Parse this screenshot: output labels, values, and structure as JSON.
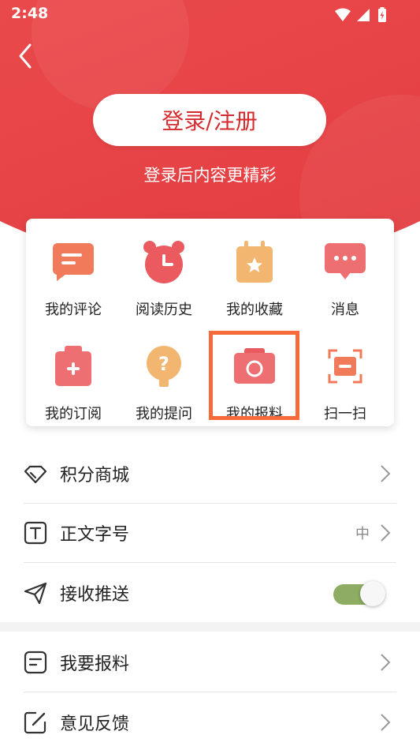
{
  "status_bar": {
    "time": "2:48"
  },
  "header": {
    "login_button": "登录/注册",
    "subtitle": "登录后内容更精彩"
  },
  "grid": {
    "items": [
      {
        "label": "我的评论",
        "icon": "comment-icon"
      },
      {
        "label": "阅读历史",
        "icon": "alarm-clock-icon"
      },
      {
        "label": "我的收藏",
        "icon": "bookmark-star-icon"
      },
      {
        "label": "消息",
        "icon": "message-icon"
      },
      {
        "label": "我的订阅",
        "icon": "subscribe-icon"
      },
      {
        "label": "我的提问",
        "icon": "question-icon"
      },
      {
        "label": "我的报料",
        "icon": "camera-icon"
      },
      {
        "label": "扫一扫",
        "icon": "scan-icon"
      }
    ],
    "highlighted": "我的报料"
  },
  "menu": {
    "points_mall": {
      "label": "积分商城",
      "icon": "diamond-icon"
    },
    "font_size": {
      "label": "正文字号",
      "value": "中",
      "icon": "text-size-icon"
    },
    "push": {
      "label": "接收推送",
      "icon": "send-icon",
      "enabled": true
    },
    "report": {
      "label": "我要报料",
      "icon": "report-icon"
    },
    "feedback": {
      "label": "意见反馈",
      "icon": "edit-icon"
    }
  },
  "colors": {
    "header": "#ea4a4c",
    "accent_text": "#d42a2d",
    "highlight_border": "#f76a3a",
    "toggle_on": "#8fad62"
  }
}
